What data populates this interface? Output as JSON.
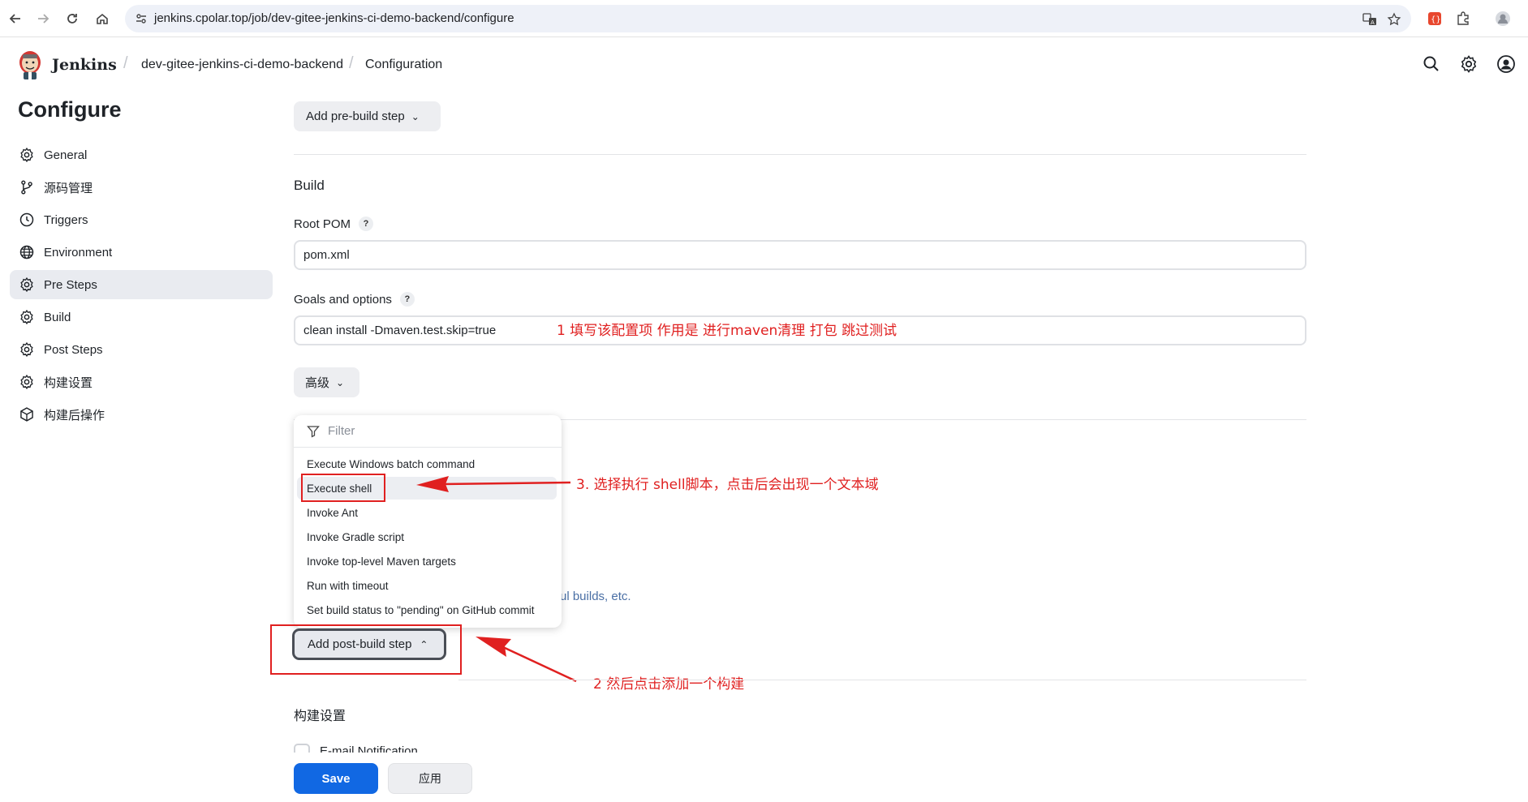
{
  "browser": {
    "url": "jenkins.cpolar.top/job/dev-gitee-jenkins-ci-demo-backend/configure"
  },
  "header": {
    "brand": "Jenkins",
    "breadcrumbs": [
      "dev-gitee-jenkins-ci-demo-backend",
      "Configuration"
    ]
  },
  "sidebar": {
    "title": "Configure",
    "items": [
      {
        "label": "General",
        "icon": "gear-icon"
      },
      {
        "label": "源码管理",
        "icon": "branch-icon"
      },
      {
        "label": "Triggers",
        "icon": "clock-icon"
      },
      {
        "label": "Environment",
        "icon": "globe-icon"
      },
      {
        "label": "Pre Steps",
        "icon": "gear-icon"
      },
      {
        "label": "Build",
        "icon": "gear-icon"
      },
      {
        "label": "Post Steps",
        "icon": "gear-icon"
      },
      {
        "label": "构建设置",
        "icon": "gear-icon"
      },
      {
        "label": "构建后操作",
        "icon": "cube-icon"
      }
    ],
    "active_index": 4
  },
  "main": {
    "add_pre_build_step": "Add pre-build step",
    "build_section_title": "Build",
    "root_pom_label": "Root POM",
    "root_pom_value": "pom.xml",
    "goals_label": "Goals and options",
    "goals_value": "clean install -Dmaven.test.skip=true",
    "advanced_button": "高级",
    "help": "?",
    "dropdown": {
      "filter_placeholder": "Filter",
      "items": [
        "Execute Windows batch command",
        "Execute shell",
        "Invoke Ant",
        "Invoke Gradle script",
        "Invoke top-level Maven targets",
        "Run with timeout",
        "Set build status to \"pending\" on GitHub commit"
      ],
      "hovered_index": 1
    },
    "partial_link_text": "ul builds, etc.",
    "add_post_build_step": "Add post-build step",
    "build_settings_title": "构建设置",
    "email_notification_partial": "E-mail Notification",
    "save_button": "Save",
    "apply_button": "应用"
  },
  "annotations": {
    "step1": "1 填写该配置项  作用是 进行maven清理 打包 跳过测试",
    "step2": "2 然后点击添加一个构建",
    "step3": "3. 选择执行 shell脚本，点击后会出现一个文本域"
  },
  "colors": {
    "accent": "#1168e3",
    "annotation_red": "#e02020",
    "active_sidebar": "#e9ebf0"
  }
}
